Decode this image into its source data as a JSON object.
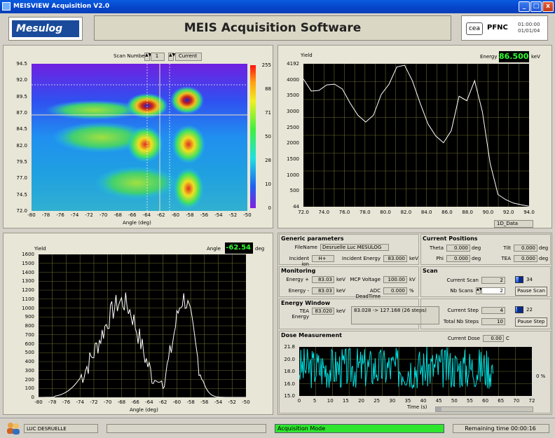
{
  "window": {
    "title": "MEISVIEW Acquisition V2.0",
    "min": "_",
    "max": "□",
    "close": "x"
  },
  "header": {
    "logo": "Mesulog",
    "title": "MEIS Acquisition Software",
    "org_logo": "cea",
    "org": "PFNC",
    "time": "01:00:00",
    "date": "01/01/04"
  },
  "scan_selector": {
    "label": "Scan Number",
    "value": "1",
    "mode": "Current"
  },
  "map": {
    "xlabel": "Angle (deg)",
    "y_ticks": [
      "94.5",
      "92.0",
      "89.5",
      "87.0",
      "84.5",
      "82.0",
      "79.5",
      "77.0",
      "74.5",
      "72.0"
    ],
    "x_ticks": [
      "-80",
      "-78",
      "-76",
      "-74",
      "-72",
      "-70",
      "-68",
      "-66",
      "-64",
      "-62",
      "-60",
      "-58",
      "-56",
      "-54",
      "-52",
      "-50"
    ],
    "scale_ticks": [
      "255",
      "88",
      "71",
      "50",
      "28",
      "10",
      "0"
    ]
  },
  "yield_energy": {
    "ylabel": "Yield",
    "energy_label": "Energy",
    "energy_value": "86.500",
    "energy_unit": "keV",
    "y_ticks": [
      "4192",
      "4000",
      "3500",
      "3000",
      "2500",
      "2000",
      "1500",
      "1000",
      "500",
      "44"
    ],
    "x_ticks": [
      "72.0",
      "74.0",
      "76.0",
      "78.0",
      "80.0",
      "82.0",
      "84.0",
      "86.0",
      "88.0",
      "90.0",
      "92.0",
      "94.0"
    ],
    "selector": "1D_Data"
  },
  "yield_angle": {
    "ylabel": "Yield",
    "angle_label": "Angle",
    "angle_value": "-62.54",
    "angle_unit": "deg",
    "xlabel": "Angle (deg)",
    "y_ticks": [
      "1600",
      "1500",
      "1400",
      "1300",
      "1200",
      "1100",
      "1000",
      "900",
      "800",
      "700",
      "600",
      "500",
      "400",
      "300",
      "200",
      "100",
      "0"
    ],
    "x_ticks": [
      "-80",
      "-78",
      "-76",
      "-74",
      "-72",
      "-70",
      "-68",
      "-66",
      "-64",
      "-62",
      "-60",
      "-58",
      "-56",
      "-54",
      "-52",
      "-50"
    ]
  },
  "generic": {
    "title": "Generic parameters",
    "filename_label": "FileName",
    "filename": "Desruelle Luc MESULOG",
    "ion_label": "Incident ion",
    "ion": "H+",
    "ienergy_label": "Incident Energy",
    "ienergy": "83.000",
    "ienergy_unit": "keV"
  },
  "positions": {
    "title": "Current Positions",
    "theta_label": "Theta",
    "theta": "0.000",
    "phi_label": "Phi",
    "phi": "0.000",
    "tilt_label": "Tilt",
    "tilt": "0.000",
    "tea_label": "TEA",
    "tea": "0.000",
    "unit": "deg"
  },
  "monitoring": {
    "title": "Monitoring",
    "eplus_label": "Energy +",
    "eplus": "83.03",
    "eminus_label": "Energy -",
    "eminus": "83.03",
    "e_unit": "keV",
    "mcp_label": "MCP Voltage",
    "mcp": "100.00",
    "mcp_unit": "kV",
    "adc_label": "ADC DeadTime",
    "adc": "0.000",
    "adc_unit": "%"
  },
  "scan": {
    "title": "Scan",
    "current_label": "Current Scan",
    "current": "2",
    "progress_value": "34",
    "progress": 0.4,
    "nb_label": "Nb Scans",
    "nb": "2",
    "pause_label": "Pause Scan"
  },
  "energy_window": {
    "title": "Energy Window",
    "tea_label": "TEA Energy",
    "tea": "83.020",
    "tea_unit": "keV",
    "range": "83.028 -> 127.168 (26 steps)",
    "step_label": "Current Step",
    "step": "4",
    "progress_value": "22",
    "progress": 0.15,
    "total_label": "Total Nb Steps",
    "total": "10",
    "pause_label": "Pause Step"
  },
  "dose": {
    "title": "Dose Measurement",
    "current_label": "Current Dose",
    "current": "0.00",
    "unit": "C",
    "xlabel": "Time (s)",
    "percent": "0 %",
    "y_ticks": [
      "21.8",
      "20.0",
      "18.0",
      "16.0",
      "15.0"
    ],
    "x_ticks": [
      "0",
      "5",
      "10",
      "15",
      "20",
      "25",
      "30",
      "35",
      "40",
      "45",
      "50",
      "55",
      "60",
      "65",
      "70",
      "72"
    ]
  },
  "status": {
    "user": "LUC DESRUELLE",
    "mode": "Acquisition Mode",
    "remaining": "Remaining time 00:00:16"
  },
  "colors": {
    "title_bar": "#0544c8",
    "plot_bg": "#000000",
    "yield_line": "#ffffff",
    "dose_line": "#00e0e0",
    "mode_green": "#2ee62e"
  }
}
